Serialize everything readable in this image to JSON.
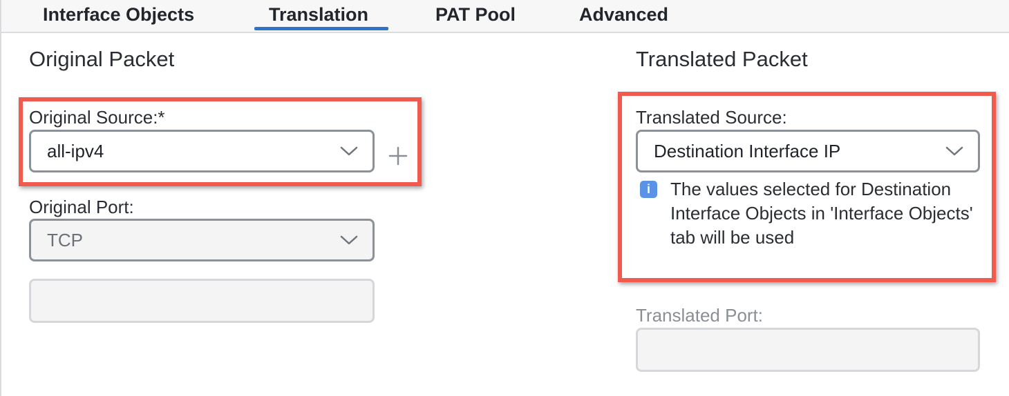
{
  "tabs": [
    {
      "label": "Interface Objects",
      "active": false
    },
    {
      "label": "Translation",
      "active": true
    },
    {
      "label": "PAT Pool",
      "active": false
    },
    {
      "label": "Advanced",
      "active": false
    }
  ],
  "original": {
    "title": "Original Packet",
    "source_label": "Original Source:*",
    "source_value": "all-ipv4",
    "port_label": "Original Port:",
    "port_value": "TCP",
    "port_number": ""
  },
  "translated": {
    "title": "Translated Packet",
    "source_label": "Translated Source:",
    "source_value": "Destination Interface IP",
    "info_text": "The values selected for Destination Interface Objects in 'Interface Objects' tab will be used",
    "port_label": "Translated Port:",
    "port_number": ""
  },
  "colors": {
    "accent": "#2f74c8",
    "highlight": "#f15a4f",
    "info": "#5a93e6"
  },
  "icons": {
    "dropdown": "chevron-down-icon",
    "add": "plus-icon",
    "info": "info-icon"
  }
}
